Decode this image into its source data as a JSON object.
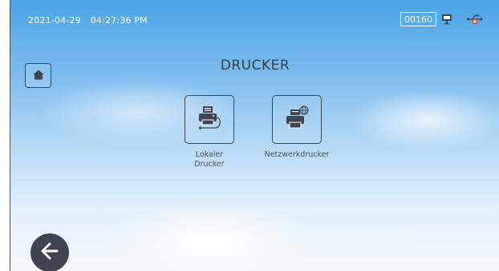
{
  "status_bar": {
    "date": "2021-04-29",
    "time": "04:27:36 PM",
    "counter": "00160",
    "icons": [
      "screen-share-icon",
      "usb-disconnected-icon"
    ]
  },
  "header": {
    "title": "DRUCKER",
    "home_icon": "home-icon"
  },
  "tiles": [
    {
      "label": "Lokaler\nDrucker",
      "icon": "local-printer-icon"
    },
    {
      "label": "Netzwerkdrucker",
      "icon": "network-printer-icon"
    }
  ],
  "footer": {
    "back_icon": "arrow-left-icon"
  },
  "colors": {
    "icon_dark": "#3f4651",
    "title_text": "#3a3f47",
    "usb_error": "#e53935"
  }
}
